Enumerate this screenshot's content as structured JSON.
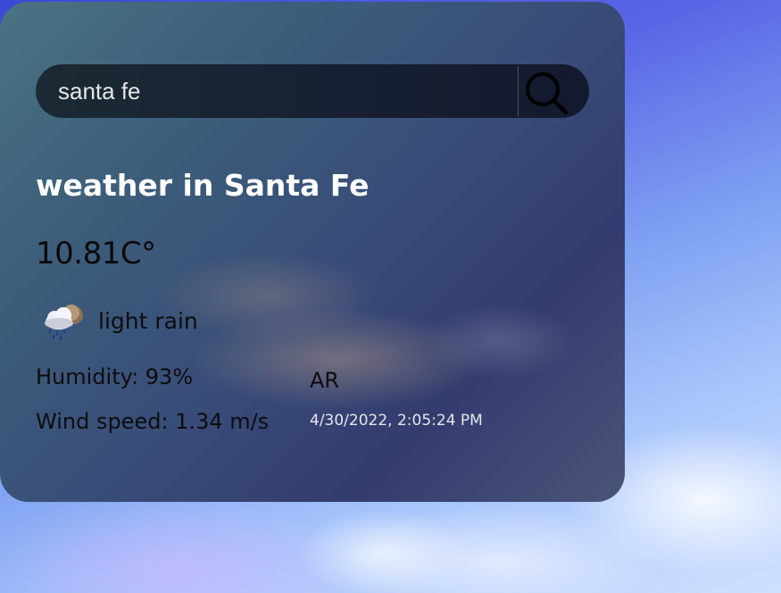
{
  "search": {
    "value": "santa fe",
    "button_icon": "search-icon"
  },
  "weather": {
    "title": "weather in Santa Fe",
    "temperature": "10.81C°",
    "condition": "light rain",
    "condition_icon": "light-rain-icon",
    "humidity": "Humidity: 93%",
    "wind": "Wind speed: 1.34 m/s",
    "country": "AR",
    "datetime": "4/30/2022, 2:05:24 PM"
  },
  "colors": {
    "title_text": "#ffffff",
    "body_text": "#0d0d0d",
    "datetime_text": "#e6e6ee",
    "search_bar_bg": "#172032"
  }
}
